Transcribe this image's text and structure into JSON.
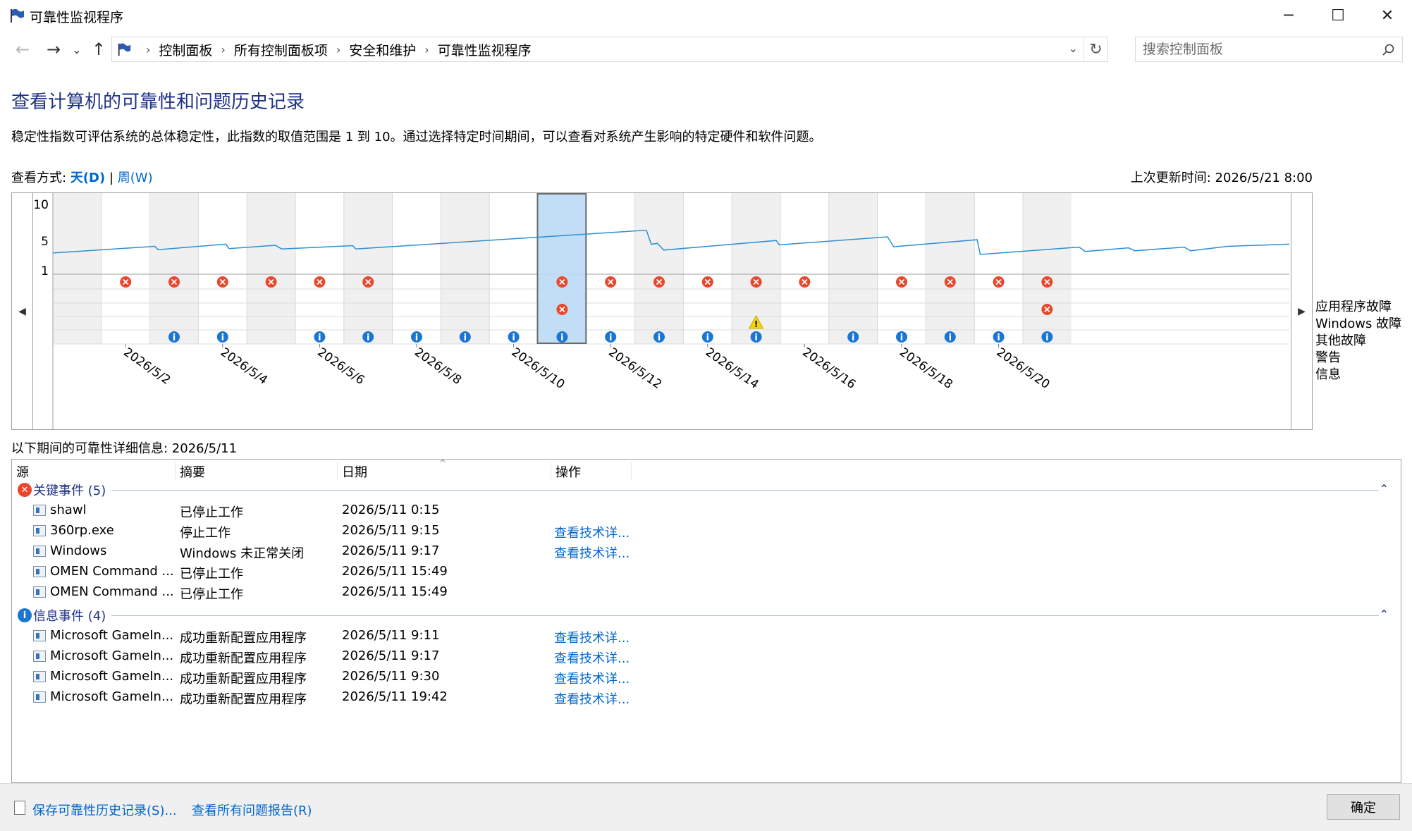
{
  "window": {
    "title": "可靠性监视程序",
    "minimize_glyph": "─",
    "maximize_glyph": "☐",
    "close_glyph": "✕"
  },
  "nav": {
    "back_glyph": "←",
    "forward_glyph": "→",
    "recent_glyph": "⌄",
    "up_glyph": "↑",
    "breadcrumb": [
      "控制面板",
      "所有控制面板项",
      "安全和维护",
      "可靠性监视程序"
    ],
    "search_placeholder": "搜索控制面板"
  },
  "heading": "查看计算机的可靠性和问题历史记录",
  "description": "稳定性指数可评估系统的总体稳定性，此指数的取值范围是 1 到 10。通过选择特定时间期间，可以查看对系统产生影响的特定硬件和软件问题。",
  "view_mode": {
    "label": "查看方式:",
    "day": "天(D)",
    "separator": "|",
    "week": "周(W)"
  },
  "last_update": "上次更新时间: 2026/5/21 8:00",
  "chart_data": {
    "type": "line",
    "ylim": [
      1,
      10
    ],
    "yticks": [
      "10",
      "5",
      "1"
    ],
    "columns": [
      "2026/5/1",
      "2026/5/2",
      "2026/5/3",
      "2026/5/4",
      "2026/5/5",
      "2026/5/6",
      "2026/5/7",
      "2026/5/8",
      "2026/5/9",
      "2026/5/10",
      "2026/5/11",
      "2026/5/12",
      "2026/5/13",
      "2026/5/14",
      "2026/5/15",
      "2026/5/16",
      "2026/5/17",
      "2026/5/18",
      "2026/5/19",
      "2026/5/20",
      "2026/5/21"
    ],
    "x_tick_labels": [
      "2026/5/2",
      "2026/5/4",
      "2026/5/6",
      "2026/5/8",
      "2026/5/10",
      "2026/5/12",
      "2026/5/14",
      "2026/5/16",
      "2026/5/18",
      "2026/5/20"
    ],
    "selected_index": 9,
    "stability_index": [
      {
        "x": 0.0,
        "y": 3.4
      },
      {
        "x": 1.65,
        "y": 4.3
      },
      {
        "x": 1.7,
        "y": 3.85
      },
      {
        "x": 2.8,
        "y": 4.6
      },
      {
        "x": 2.85,
        "y": 4.0
      },
      {
        "x": 3.6,
        "y": 4.45
      },
      {
        "x": 3.7,
        "y": 3.95
      },
      {
        "x": 4.85,
        "y": 4.4
      },
      {
        "x": 4.9,
        "y": 3.95
      },
      {
        "x": 9.6,
        "y": 6.5
      },
      {
        "x": 9.68,
        "y": 4.6
      },
      {
        "x": 9.78,
        "y": 4.7
      },
      {
        "x": 9.88,
        "y": 3.8
      },
      {
        "x": 11.7,
        "y": 5.1
      },
      {
        "x": 11.75,
        "y": 4.5
      },
      {
        "x": 13.5,
        "y": 5.6
      },
      {
        "x": 13.6,
        "y": 4.25
      },
      {
        "x": 14.95,
        "y": 5.2
      },
      {
        "x": 15.0,
        "y": 3.2
      },
      {
        "x": 16.6,
        "y": 4.2
      },
      {
        "x": 16.7,
        "y": 3.6
      },
      {
        "x": 17.4,
        "y": 4.1
      },
      {
        "x": 17.5,
        "y": 3.7
      },
      {
        "x": 18.3,
        "y": 4.2
      },
      {
        "x": 18.4,
        "y": 3.7
      },
      {
        "x": 19.0,
        "y": 4.3
      },
      {
        "x": 20.0,
        "y": 4.6
      }
    ],
    "event_rows": [
      "应用程序故障",
      "Windows 故障",
      "其他故障",
      "警告",
      "信息"
    ],
    "events": {
      "app_failure": [
        1,
        2,
        3,
        4,
        5,
        6,
        10,
        11,
        12,
        13,
        14,
        15,
        17,
        18,
        19,
        20
      ],
      "windows_failure": [],
      "other_failure": [
        10,
        20
      ],
      "warning": [
        14
      ],
      "info": [
        2,
        3,
        5,
        6,
        7,
        8,
        9,
        10,
        11,
        12,
        13,
        14,
        16,
        17,
        18,
        19,
        20
      ]
    },
    "colors": {
      "line": "#2b8fd6",
      "critical": "#e8472b",
      "info": "#1a76d2",
      "warning": "#f6d20a",
      "selected": "#bcdcf6",
      "alt_col": "#f0f0f0"
    }
  },
  "legend": [
    "应用程序故障",
    "Windows 故障",
    "其他故障",
    "警告",
    "信息"
  ],
  "details": {
    "title": "以下期间的可靠性详细信息: 2026/5/11",
    "columns": [
      "源",
      "摘要",
      "日期",
      "操作"
    ],
    "groups": [
      {
        "label": "关键事件 (5)",
        "type": "critical",
        "rows": [
          {
            "source": "shawl",
            "summary": "已停止工作",
            "date": "2026/5/11 0:15",
            "action": ""
          },
          {
            "source": "360rp.exe",
            "summary": "停止工作",
            "date": "2026/5/11 9:15",
            "action": "查看技术详..."
          },
          {
            "source": "Windows",
            "summary": "Windows 未正常关闭",
            "date": "2026/5/11 9:17",
            "action": "查看技术详..."
          },
          {
            "source": "OMEN Command ...",
            "summary": "已停止工作",
            "date": "2026/5/11 15:49",
            "action": ""
          },
          {
            "source": "OMEN Command ...",
            "summary": "已停止工作",
            "date": "2026/5/11 15:49",
            "action": ""
          }
        ]
      },
      {
        "label": "信息事件 (4)",
        "type": "info",
        "rows": [
          {
            "source": "Microsoft GameIn...",
            "summary": "成功重新配置应用程序",
            "date": "2026/5/11 9:11",
            "action": "查看技术详..."
          },
          {
            "source": "Microsoft GameIn...",
            "summary": "成功重新配置应用程序",
            "date": "2026/5/11 9:17",
            "action": "查看技术详..."
          },
          {
            "source": "Microsoft GameIn...",
            "summary": "成功重新配置应用程序",
            "date": "2026/5/11 9:30",
            "action": "查看技术详..."
          },
          {
            "source": "Microsoft GameIn...",
            "summary": "成功重新配置应用程序",
            "date": "2026/5/11 19:42",
            "action": "查看技术详..."
          }
        ]
      }
    ]
  },
  "footer": {
    "save_link": "保存可靠性历史记录(S)...",
    "reports_link": "查看所有问题报告(R)",
    "ok_button": "确定"
  }
}
